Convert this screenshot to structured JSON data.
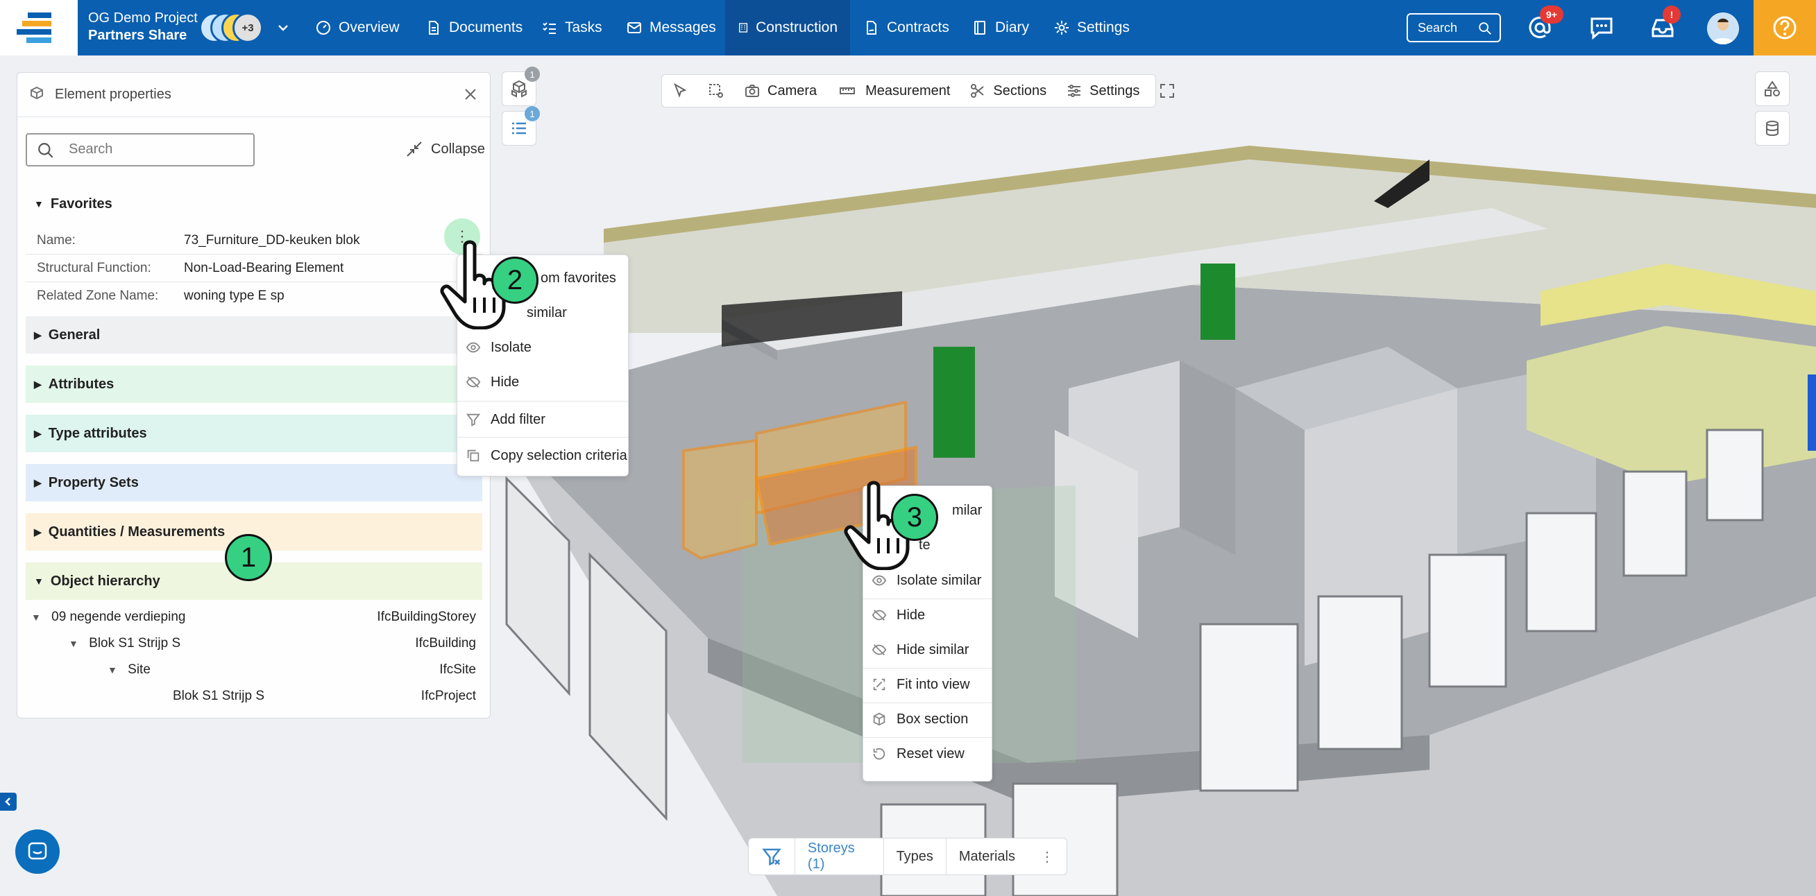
{
  "header": {
    "project_name": "OG Demo Project",
    "project_share": "Partners Share",
    "avatars_extra": "+3",
    "nav": [
      "Overview",
      "Documents",
      "Tasks",
      "Messages",
      "Construction",
      "Contracts",
      "Diary",
      "Settings"
    ],
    "active_nav": "Construction",
    "search_label": "Search",
    "mentions_badge": "9+",
    "notifications_badge": "!"
  },
  "toolbar": {
    "camera": "Camera",
    "measurement": "Measurement",
    "sections": "Sections",
    "settings": "Settings"
  },
  "side_badges": {
    "models": "1",
    "list": "1"
  },
  "panel": {
    "title": "Element properties",
    "search_placeholder": "Search",
    "collapse": "Collapse",
    "favorites_title": "Favorites",
    "favorites": [
      {
        "key": "Name:",
        "value": "73_Furniture_DD-keuken blok"
      },
      {
        "key": "Structural Function:",
        "value": "Non-Load-Bearing Element"
      },
      {
        "key": "Related Zone Name:",
        "value": "woning type E sp"
      }
    ],
    "sections": [
      "General",
      "Attributes",
      "Type attributes",
      "Property Sets",
      "Quantities / Measurements",
      "Object hierarchy"
    ],
    "section_colors": [
      "#eef0f2",
      "#e2f7ea",
      "#ddf4ef",
      "#e1ecfa",
      "#fdf1dc",
      "#eef6df"
    ],
    "hierarchy": [
      {
        "name": "09 negende verdieping",
        "type": "IfcBuildingStorey"
      },
      {
        "name": "Blok S1 Strijp S",
        "type": "IfcBuilding"
      },
      {
        "name": "Site",
        "type": "IfcSite"
      },
      {
        "name": "Blok S1 Strijp S",
        "type": "IfcProject"
      }
    ]
  },
  "favorites_menu": [
    "om favorites",
    "similar",
    "Isolate",
    "Hide",
    "Add filter",
    "Copy selection criteria"
  ],
  "context_menu": [
    "milar",
    "te",
    "Isolate similar",
    "Hide",
    "Hide similar",
    "Fit into view",
    "Box section",
    "Reset view"
  ],
  "filter_bar": {
    "storeys": "Storeys (1)",
    "types": "Types",
    "materials": "Materials"
  },
  "steps": [
    "1",
    "2",
    "3"
  ],
  "colors": {
    "brand": "#0a5fb0",
    "help": "#f5a623",
    "step": "#36d083",
    "selection": "#ff8a00"
  }
}
